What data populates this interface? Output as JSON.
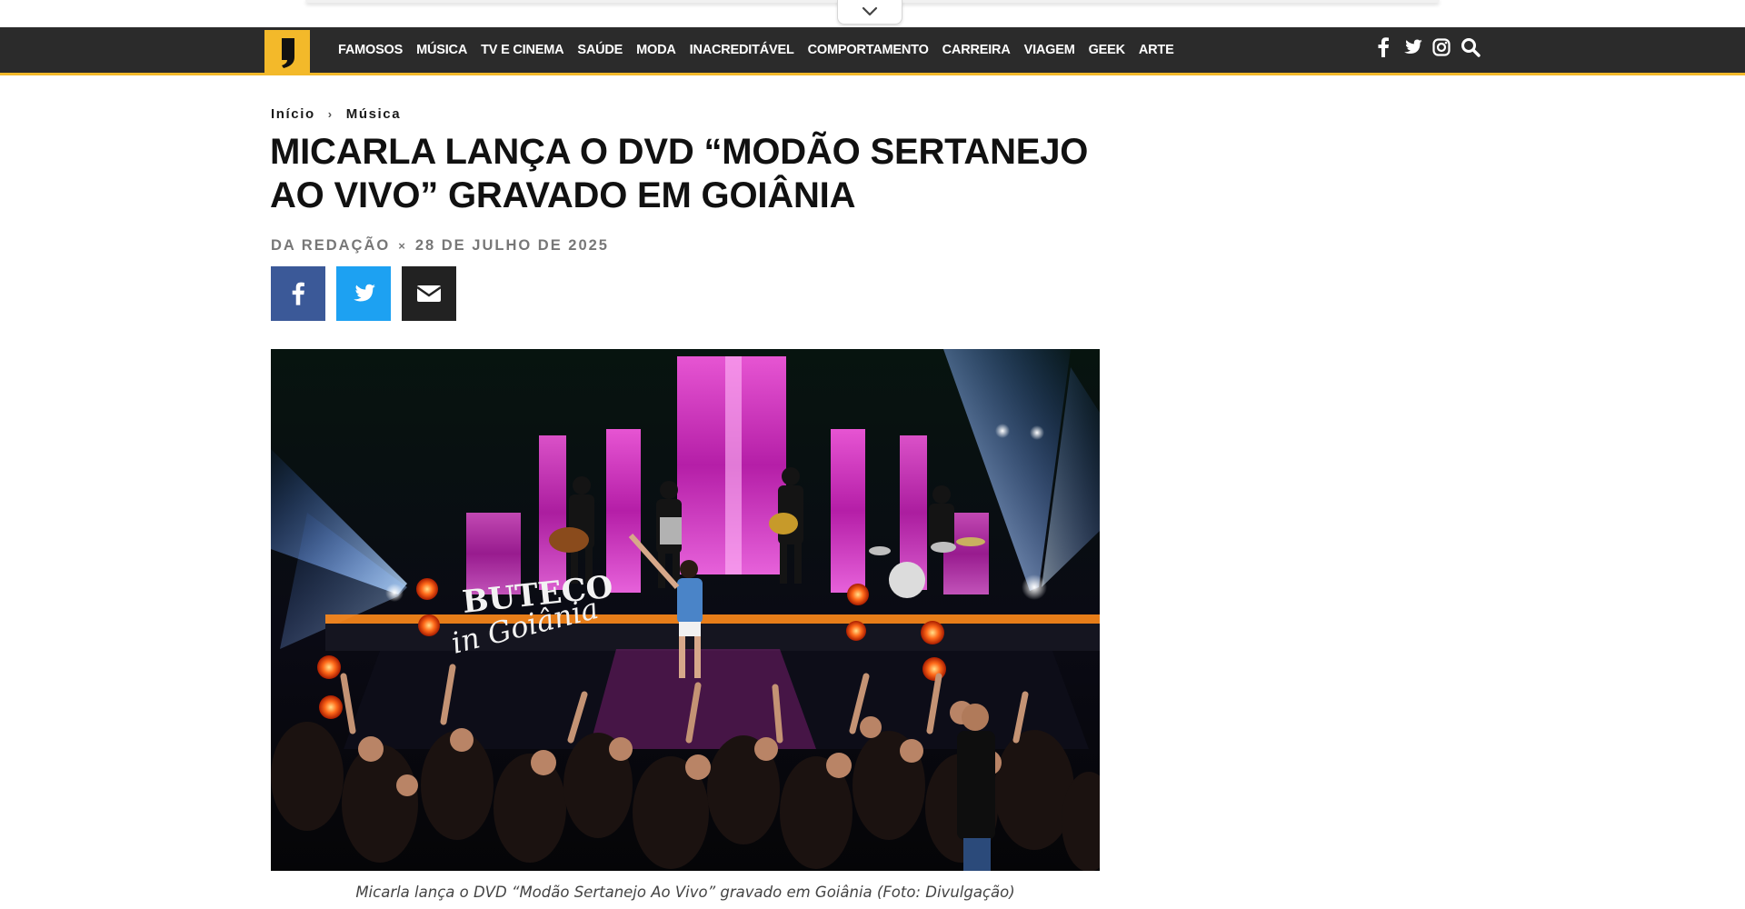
{
  "nav": {
    "menu": [
      {
        "label": "FAMOSOS"
      },
      {
        "label": "MÚSICA"
      },
      {
        "label": "TV E CINEMA"
      },
      {
        "label": "SAÚDE"
      },
      {
        "label": "MODA"
      },
      {
        "label": "INACREDITÁVEL"
      },
      {
        "label": "COMPORTAMENTO"
      },
      {
        "label": "CARREIRA"
      },
      {
        "label": "VIAGEM"
      },
      {
        "label": "GEEK"
      },
      {
        "label": "ARTE"
      }
    ],
    "icons": [
      "facebook-icon",
      "twitter-icon",
      "instagram-icon",
      "search-icon"
    ],
    "accent": "#f3b92a",
    "bar_color": "#2b2b2b"
  },
  "breadcrumb": {
    "home": "Início",
    "category": "Música"
  },
  "article": {
    "title": "MICARLA LANÇA O DVD “MODÃO SERTANEJO AO VIVO” GRAVADO EM GOIÂNIA",
    "author": "DA REDAÇÃO",
    "separator": "×",
    "date": "28 DE JULHO DE 2025",
    "caption": "Micarla lança o DVD “Modão Sertanejo Ao Vivo” gravado em Goiânia (Foto: Divulgação)",
    "image_text": {
      "line1": "BUTECO",
      "line2": "in Goiânia"
    }
  },
  "share": {
    "buttons": [
      "facebook",
      "twitter",
      "email"
    ],
    "colors": {
      "facebook": "#3b5998",
      "twitter": "#1da1f2",
      "email": "#222222"
    }
  }
}
